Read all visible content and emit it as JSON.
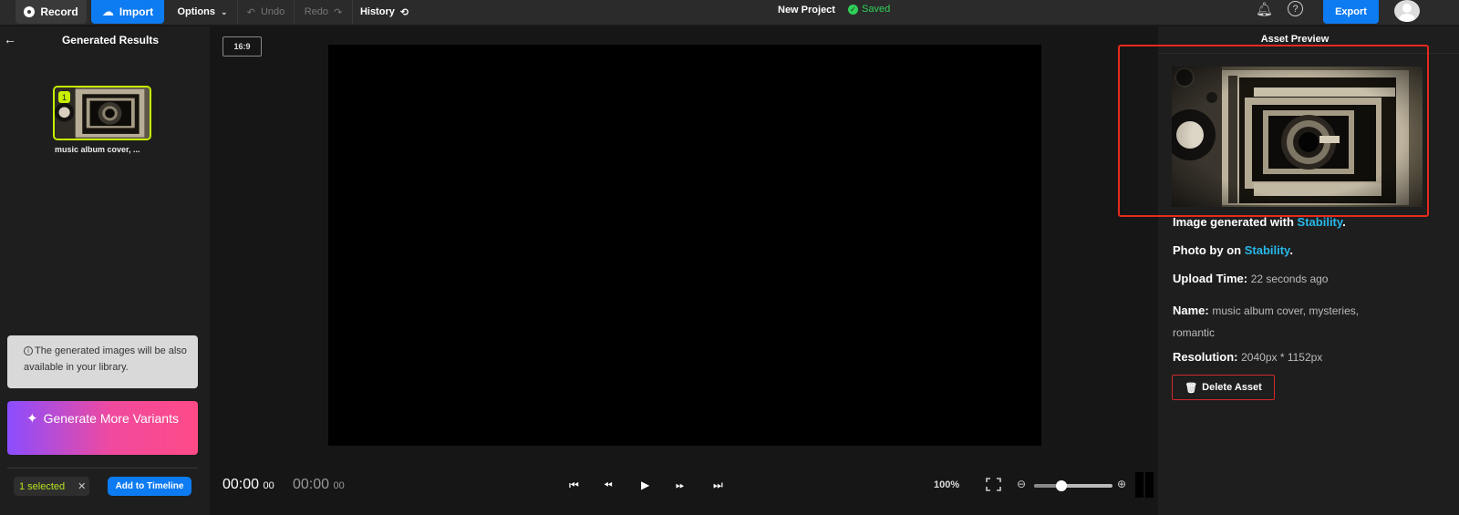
{
  "topbar": {
    "record_label": "Record",
    "import_label": "Import",
    "options_label": "Options",
    "undo_label": "Undo",
    "redo_label": "Redo",
    "history_label": "History",
    "project_title": "New Project",
    "saved_label": "Saved",
    "export_label": "Export"
  },
  "left_panel": {
    "title": "Generated Results",
    "results": [
      {
        "index": "1",
        "label": "music album cover, ..."
      }
    ],
    "info_text": "The generated images will be also available in your library.",
    "generate_label": "Generate More Variants",
    "selected_label": "1 selected",
    "add_timeline_label": "Add to Timeline"
  },
  "center": {
    "aspect_ratio": "16:9",
    "current_time": "00:00",
    "current_frames": "00",
    "total_time": "00:00",
    "total_frames": "00",
    "zoom_label": "100%",
    "zoom_slider_value": 0.35
  },
  "right_panel": {
    "title": "Asset Preview",
    "generated_with_prefix": "Image generated with ",
    "generated_with_link": "Stability",
    "photo_by_prefix": "Photo by on ",
    "photo_by_link": "Stability",
    "upload_time_label": "Upload Time:",
    "upload_time_value": "22 seconds ago",
    "name_label": "Name:",
    "name_value": "music album cover, mysteries, romantic",
    "resolution_label": "Resolution:",
    "resolution_value": "2040px * 1152px",
    "delete_label": "Delete Asset"
  },
  "colors": {
    "accent_blue": "#0d7bf2",
    "saved_green": "#2fd159",
    "selection_lime": "#c8f000",
    "link_cyan": "#28b7e8",
    "danger_red": "#d12c2c",
    "highlight_red": "#e62a1e"
  }
}
